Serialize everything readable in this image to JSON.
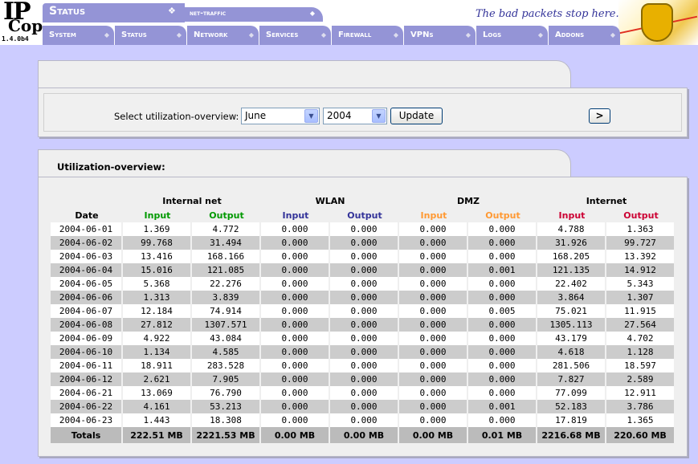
{
  "app": {
    "logo_ip": "IP",
    "logo_cop": "Cop",
    "version": "1.4.0b4",
    "section": "Status",
    "subtab": "net-traffic",
    "tagline": "The bad packets stop here."
  },
  "nav": [
    "System",
    "Status",
    "Network",
    "Services",
    "Firewall",
    "VPNs",
    "Logs",
    "Addons"
  ],
  "form": {
    "label": "Select utilization-overview:",
    "month": "June",
    "year": "2004",
    "update": "Update",
    "next": ">"
  },
  "overview": {
    "title": "Utilization-overview:",
    "groups": [
      "Internal net",
      "WLAN",
      "DMZ",
      "Internet"
    ],
    "date_header": "Date",
    "input": "Input",
    "output": "Output",
    "colors": {
      "internal": "#009900",
      "wlan": "#333399",
      "dmz": "#ff9933",
      "internet": "#cc0033"
    },
    "rows": [
      [
        "2004-06-01",
        "1.369",
        "4.772",
        "0.000",
        "0.000",
        "0.000",
        "0.000",
        "4.788",
        "1.363"
      ],
      [
        "2004-06-02",
        "99.768",
        "31.494",
        "0.000",
        "0.000",
        "0.000",
        "0.000",
        "31.926",
        "99.727"
      ],
      [
        "2004-06-03",
        "13.416",
        "168.166",
        "0.000",
        "0.000",
        "0.000",
        "0.000",
        "168.205",
        "13.392"
      ],
      [
        "2004-06-04",
        "15.016",
        "121.085",
        "0.000",
        "0.000",
        "0.000",
        "0.001",
        "121.135",
        "14.912"
      ],
      [
        "2004-06-05",
        "5.368",
        "22.276",
        "0.000",
        "0.000",
        "0.000",
        "0.000",
        "22.402",
        "5.343"
      ],
      [
        "2004-06-06",
        "1.313",
        "3.839",
        "0.000",
        "0.000",
        "0.000",
        "0.000",
        "3.864",
        "1.307"
      ],
      [
        "2004-06-07",
        "12.184",
        "74.914",
        "0.000",
        "0.000",
        "0.000",
        "0.005",
        "75.021",
        "11.915"
      ],
      [
        "2004-06-08",
        "27.812",
        "1307.571",
        "0.000",
        "0.000",
        "0.000",
        "0.000",
        "1305.113",
        "27.564"
      ],
      [
        "2004-06-09",
        "4.922",
        "43.084",
        "0.000",
        "0.000",
        "0.000",
        "0.000",
        "43.179",
        "4.702"
      ],
      [
        "2004-06-10",
        "1.134",
        "4.585",
        "0.000",
        "0.000",
        "0.000",
        "0.000",
        "4.618",
        "1.128"
      ],
      [
        "2004-06-11",
        "18.911",
        "283.528",
        "0.000",
        "0.000",
        "0.000",
        "0.000",
        "281.506",
        "18.597"
      ],
      [
        "2004-06-12",
        "2.621",
        "7.905",
        "0.000",
        "0.000",
        "0.000",
        "0.000",
        "7.827",
        "2.589"
      ],
      [
        "2004-06-21",
        "13.069",
        "76.790",
        "0.000",
        "0.000",
        "0.000",
        "0.000",
        "77.099",
        "12.911"
      ],
      [
        "2004-06-22",
        "4.161",
        "53.213",
        "0.000",
        "0.000",
        "0.000",
        "0.001",
        "52.183",
        "3.786"
      ],
      [
        "2004-06-23",
        "1.443",
        "18.308",
        "0.000",
        "0.000",
        "0.000",
        "0.000",
        "17.819",
        "1.365"
      ]
    ],
    "totals": [
      "Totals",
      "222.51 MB",
      "2221.53 MB",
      "0.00 MB",
      "0.00 MB",
      "0.00 MB",
      "0.01 MB",
      "2216.68 MB",
      "220.60 MB"
    ]
  }
}
